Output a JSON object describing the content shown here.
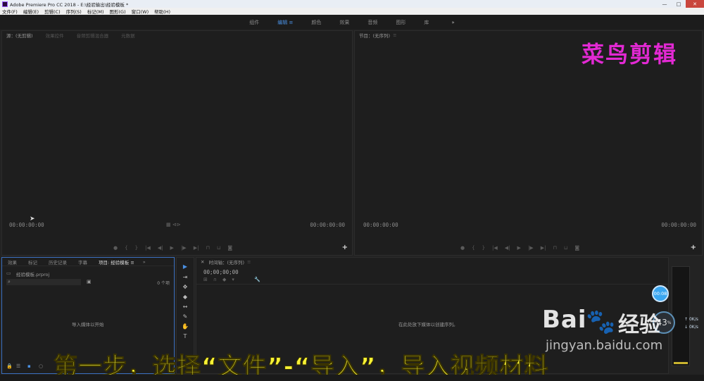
{
  "window": {
    "title": "Adobe Premiere Pro CC 2018 - E:\\经验输出\\经验模板 *",
    "controls": [
      "—",
      "□",
      "✕"
    ]
  },
  "menu": [
    "文件(F)",
    "编辑(E)",
    "剪辑(C)",
    "序列(S)",
    "标记(M)",
    "图形(G)",
    "窗口(W)",
    "帮助(H)"
  ],
  "workspaces": {
    "items": [
      "组件",
      "编辑",
      "颜色",
      "效果",
      "音频",
      "图形",
      "库"
    ],
    "active": "编辑",
    "active_marker": "≡",
    "more": "»"
  },
  "source_panel": {
    "tabs": [
      "源：(无剪辑)",
      "效果控件",
      "音频剪辑混合器",
      "元数据"
    ],
    "timecode_left": "00:00:00:00",
    "timecode_right": "00:00:00:00",
    "add": "+"
  },
  "program_panel": {
    "tab": "节目：(无序列)",
    "menu": "≡",
    "timecode_left": "00:00:00:00",
    "timecode_right": "00:00:00:00",
    "add": "+"
  },
  "project_panel": {
    "tabs": [
      "效果",
      "标记",
      "历史记录",
      "字幕",
      "项目: 经验模板"
    ],
    "active_tab": "项目: 经验模板",
    "tab_menu": "≡",
    "more": "»",
    "file": "经验模板.prproj",
    "item_count": "0 个项",
    "empty_hint": "导入媒体以开始"
  },
  "timeline": {
    "tab": "时间轴：(无序列)",
    "menu": "≡",
    "timecode": "00;00;00;00",
    "empty_hint": "在此处放下媒体以创建序列。"
  },
  "tools": [
    "▶",
    "⇥",
    "✥",
    "◆",
    "↔",
    "✎",
    "✋",
    "T"
  ],
  "overlay": {
    "brand": "菜鸟剪辑",
    "step_caption": "第一步，选择“文件”-“导入”，导入视频材料",
    "watermark_bai": "Bai",
    "watermark_paw": "🐾",
    "watermark_jingyan": "经验",
    "watermark_url": "jingyan.baidu.com"
  },
  "system_widgets": {
    "float_time": "00:08",
    "gauge_value": "43",
    "gauge_unit": "%",
    "net_up": "0K/s",
    "net_down": "0K/s"
  },
  "colors": {
    "accent": "#4a90e2",
    "brand": "#e229d3",
    "caption": "#f7f235"
  }
}
